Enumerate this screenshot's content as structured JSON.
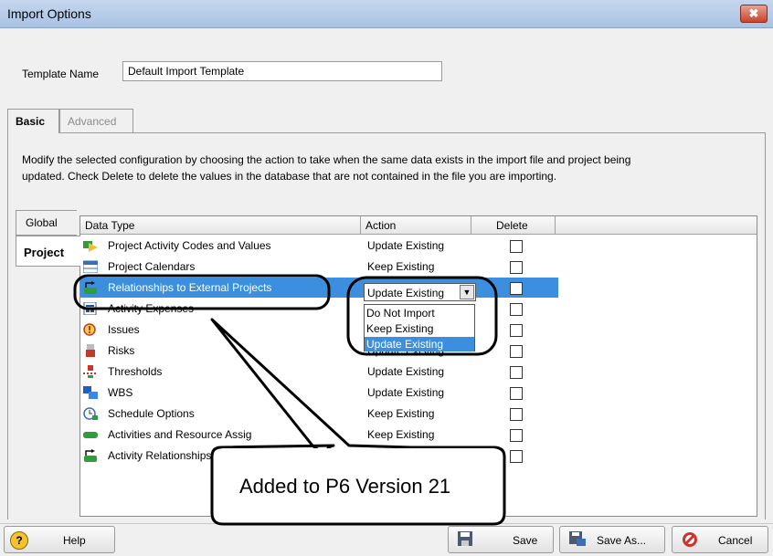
{
  "window": {
    "title": "Import Options",
    "close": "✖"
  },
  "template": {
    "label": "Template Name",
    "value": "Default Import Template"
  },
  "tabs": {
    "basic": "Basic",
    "advanced": "Advanced"
  },
  "instructions": "Modify the selected configuration by choosing the action to take when the same data exists in the import file and project being updated. Check Delete  to delete the values in the database that are not contained in the file you are importing.",
  "side_tabs": {
    "global": "Global",
    "project": "Project"
  },
  "grid": {
    "columns": {
      "data_type": "Data Type",
      "action": "Action",
      "delete": "Delete"
    },
    "rows": [
      {
        "name": "Project Activity Codes and Values",
        "action": "Update Existing",
        "icon": "activity-codes-icon",
        "selected": false
      },
      {
        "name": "Project Calendars",
        "action": "Keep Existing",
        "icon": "calendar-icon",
        "selected": false
      },
      {
        "name": "Relationships to External Projects",
        "action": "",
        "icon": "external-relationship-icon",
        "selected": true
      },
      {
        "name": "Activity Expenses",
        "action": "",
        "icon": "expenses-icon",
        "selected": false
      },
      {
        "name": "Issues",
        "action": "",
        "icon": "issue-icon",
        "selected": false
      },
      {
        "name": "Risks",
        "action": "Update Existing",
        "icon": "risk-icon",
        "selected": false
      },
      {
        "name": "Thresholds",
        "action": "Update Existing",
        "icon": "threshold-icon",
        "selected": false
      },
      {
        "name": "WBS",
        "action": "Update Existing",
        "icon": "wbs-icon",
        "selected": false
      },
      {
        "name": "Schedule Options",
        "action": "Keep Existing",
        "icon": "schedule-options-icon",
        "selected": false
      },
      {
        "name": "Activities and Resource Assig",
        "action": "Keep Existing",
        "icon": "activity-icon",
        "selected": false
      },
      {
        "name": "Activity Relationships (",
        "action": "",
        "icon": "relationship-icon",
        "selected": false
      }
    ]
  },
  "dropdown": {
    "value": "Update Existing",
    "options": [
      "Do Not Import",
      "Keep Existing",
      "Update Existing"
    ],
    "highlighted": "Update Existing"
  },
  "callout": {
    "text": "Added to P6 Version 21"
  },
  "buttons": {
    "help": "Help",
    "save": "Save",
    "save_as": "Save As...",
    "cancel": "Cancel"
  },
  "colors": {
    "selection": "#3b8fde",
    "titlebar": "#b9cde8",
    "close": "#c8442f"
  }
}
